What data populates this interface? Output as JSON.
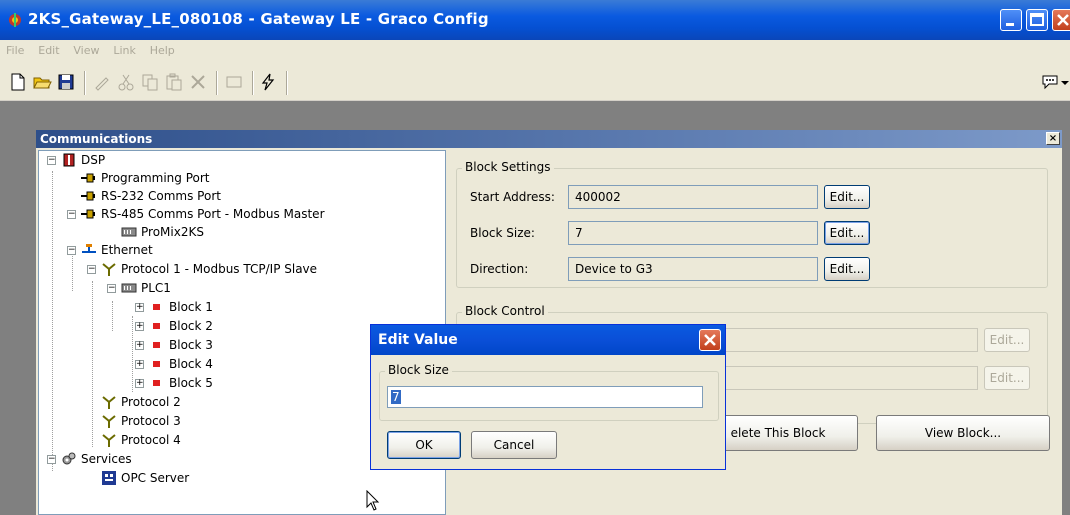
{
  "window": {
    "title": "2KS_Gateway_LE_080108 - Gateway LE - Graco Config"
  },
  "menu": [
    "File",
    "Edit",
    "View",
    "Link",
    "Help"
  ],
  "toolbar": {
    "buttons": [
      "new-file-icon",
      "open-folder-icon",
      "save-icon",
      "pencil-icon",
      "cut-icon",
      "copy-icon",
      "paste-icon",
      "delete-icon",
      "window-icon",
      "lightning-icon",
      "chat-icon"
    ]
  },
  "panel": {
    "title": "Communications",
    "close_glyph": "×"
  },
  "tree": {
    "dsp": "DSP",
    "programming_port": "Programming Port",
    "rs232": "RS-232 Comms Port",
    "rs485": "RS-485 Comms Port - Modbus Master",
    "promix": "ProMix2KS",
    "ethernet": "Ethernet",
    "protocol1": "Protocol 1 - Modbus TCP/IP Slave",
    "plc1": "PLC1",
    "blocks": [
      "Block 1",
      "Block 2",
      "Block 3",
      "Block 4",
      "Block 5"
    ],
    "protocol2": "Protocol 2",
    "protocol3": "Protocol 3",
    "protocol4": "Protocol 4",
    "services": "Services",
    "opc": "OPC Server"
  },
  "block_settings": {
    "legend": "Block Settings",
    "start_address_label": "Start Address:",
    "start_address_value": "400002",
    "block_size_label": "Block Size:",
    "block_size_value": "7",
    "direction_label": "Direction:",
    "direction_value": "Device to G3",
    "edit_label": "Edit..."
  },
  "block_control": {
    "legend": "Block Control",
    "edit_label": "Edit...",
    "delete_button": "elete This Block",
    "view_button": "View Block..."
  },
  "dialog": {
    "title": "Edit Value",
    "group_label": "Block Size",
    "input_value": "7",
    "ok_label": "OK",
    "cancel_label": "Cancel"
  },
  "colors": {
    "titlebar": "#0a5ae0",
    "panel_header": "#2e4f8a",
    "block_icon": "#e02020"
  }
}
